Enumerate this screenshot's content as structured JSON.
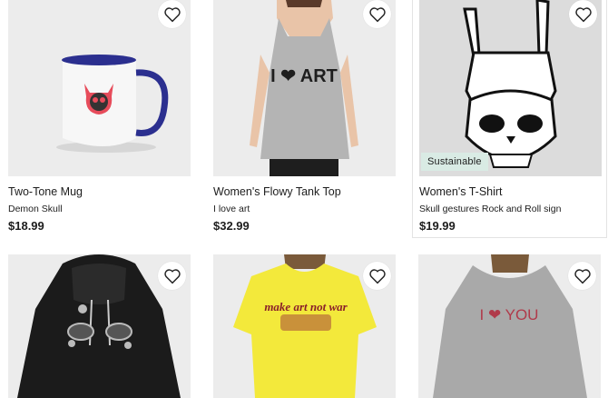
{
  "products": [
    {
      "title": "Two-Tone Mug",
      "subtitle": "Demon Skull",
      "price": "$18.99",
      "badge": ""
    },
    {
      "title": "Women's Flowy Tank Top",
      "subtitle": "I love art",
      "price": "$32.99",
      "badge": "",
      "print_text": "I ❤ ART"
    },
    {
      "title": "Women's T-Shirt",
      "subtitle": "Skull gestures Rock and Roll sign",
      "price": "$19.99",
      "badge": "Sustainable"
    },
    {
      "title": "",
      "subtitle": "",
      "price": "",
      "badge": ""
    },
    {
      "title": "",
      "subtitle": "",
      "price": "",
      "badge": "",
      "print_text": "make art not war"
    },
    {
      "title": "",
      "subtitle": "",
      "price": "",
      "badge": "",
      "print_text": "I ❤ YOU"
    }
  ],
  "icons": {
    "favorite": "heart-outline-icon"
  },
  "colors": {
    "badge_bg": "#d9ebe4",
    "card_bg": "#ececec",
    "mug_accent": "#2b2f8f",
    "shirt_yellow": "#f3e93b"
  }
}
